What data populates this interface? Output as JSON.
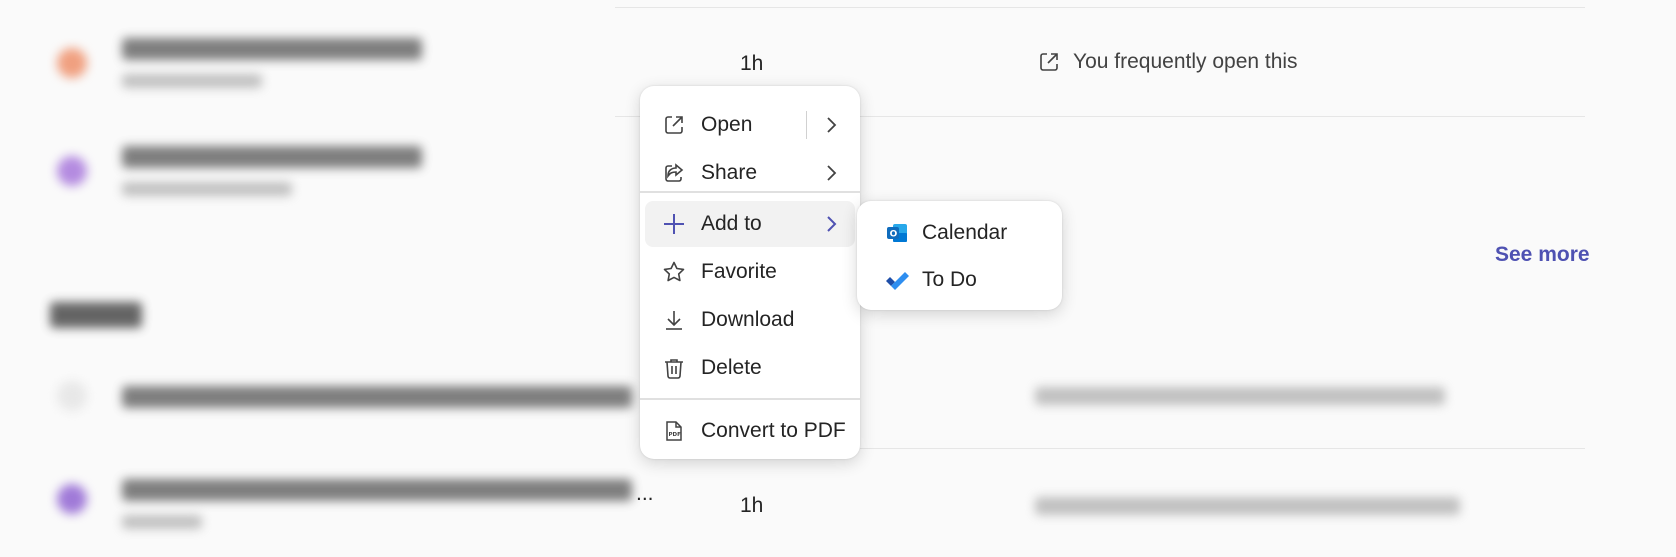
{
  "rows": [
    {
      "time": "1h",
      "activity": "You frequently open this"
    },
    {
      "time": "1h",
      "activity": ""
    }
  ],
  "see_more": "See more",
  "truncation": "...",
  "context_menu": {
    "items": [
      {
        "label": "Open",
        "icon": "open-external-icon"
      },
      {
        "label": "Share",
        "icon": "share-icon"
      },
      {
        "label": "Add to",
        "icon": "plus-icon"
      },
      {
        "label": "Favorite",
        "icon": "star-icon"
      },
      {
        "label": "Download",
        "icon": "download-icon"
      },
      {
        "label": "Delete",
        "icon": "trash-icon"
      },
      {
        "label": "Convert to PDF",
        "icon": "pdf-icon"
      }
    ]
  },
  "submenu": {
    "items": [
      {
        "label": "Calendar",
        "icon": "outlook-icon"
      },
      {
        "label": "To Do",
        "icon": "todo-check-icon"
      }
    ]
  },
  "colors": {
    "accent": "#4f52b2",
    "outlook": "#0f6cbd",
    "todo": "#2564cf"
  }
}
